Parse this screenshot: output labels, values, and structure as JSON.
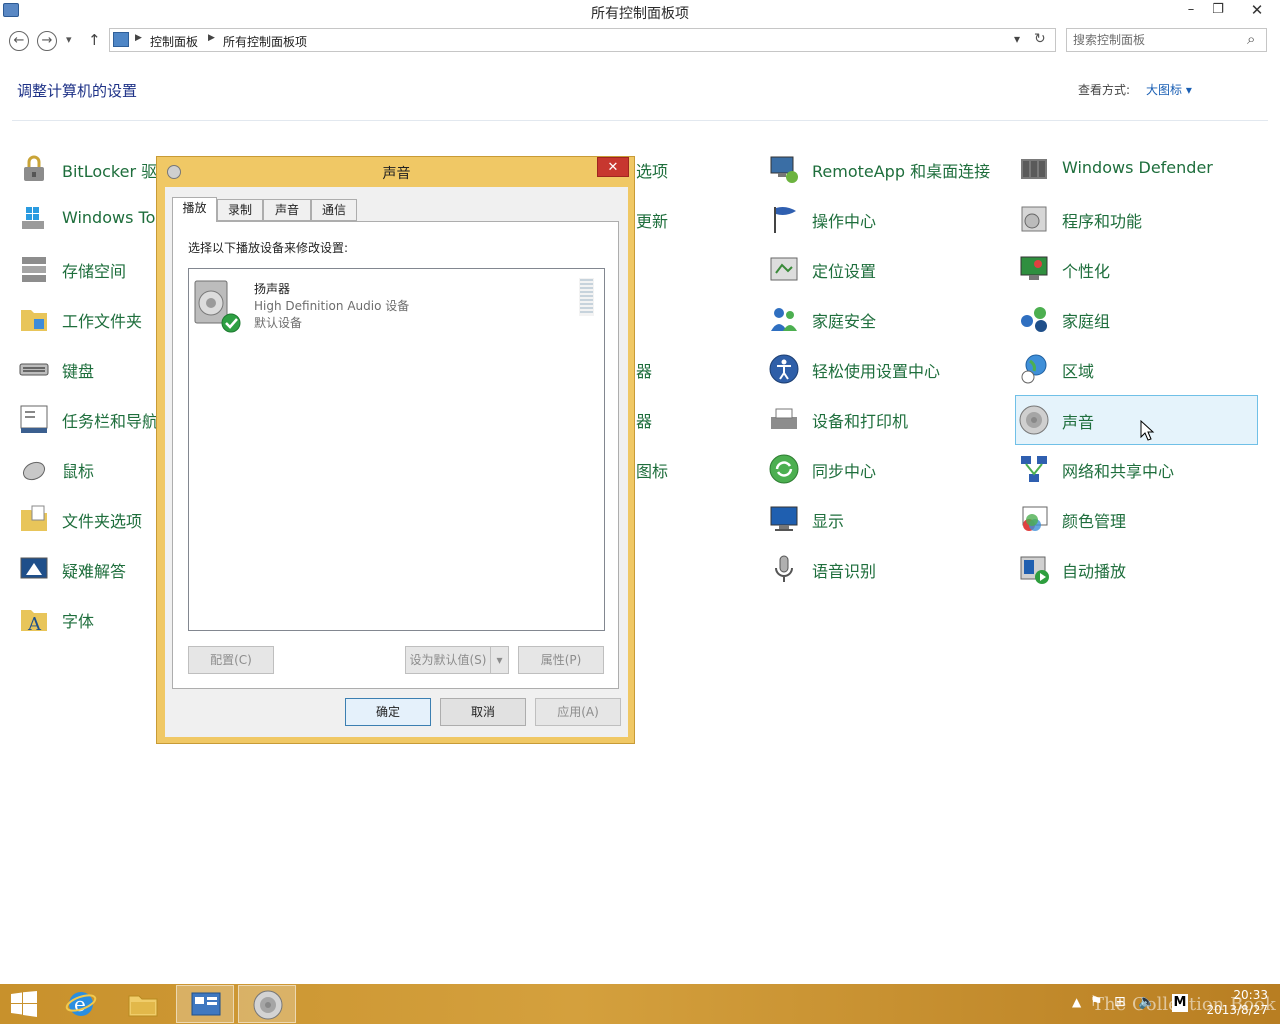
{
  "window": {
    "title": "所有控制面板项",
    "minimize": "–",
    "restore": "❐",
    "close": "✕"
  },
  "nav": {
    "back": "←",
    "forward": "→",
    "recent": "▾",
    "up": "↑",
    "breadcrumb": [
      "控制面板",
      "所有控制面板项"
    ],
    "address_dropdown": "▾",
    "refresh": "↻",
    "search_placeholder": "搜索控制面板",
    "search_icon": "⌕"
  },
  "header": {
    "title": "调整计算机的设置",
    "view_by_label": "查看方式:",
    "view_by_value": "大图标 ▾"
  },
  "items": {
    "col1": [
      "BitLocker 驱",
      "Windows To",
      "存储空间",
      "工作文件夹",
      "键盘",
      "任务栏和导航",
      "鼠标",
      "文件夹选项",
      "疑难解答",
      "字体"
    ],
    "col2_partial": [
      "选项",
      "更新",
      "器",
      "器",
      "图标"
    ],
    "col3": [
      "RemoteApp 和桌面连接",
      "操作中心",
      "定位设置",
      "家庭安全",
      "轻松使用设置中心",
      "设备和打印机",
      "同步中心",
      "显示",
      "语音识别"
    ],
    "col4": [
      "Windows Defender",
      "程序和功能",
      "个性化",
      "家庭组",
      "区域",
      "声音",
      "网络和共享中心",
      "颜色管理",
      "自动播放"
    ],
    "selected": "声音"
  },
  "dialog": {
    "title": "声音",
    "close": "✕",
    "tabs": [
      "播放",
      "录制",
      "声音",
      "通信"
    ],
    "active_tab": "播放",
    "instruction": "选择以下播放设备来修改设置:",
    "device": {
      "name": "扬声器",
      "description": "High Definition Audio 设备",
      "status": "默认设备"
    },
    "buttons": {
      "configure": "配置(C)",
      "set_default": "设为默认值(S)",
      "set_default_arrow": "▾",
      "properties": "属性(P)",
      "ok": "确定",
      "cancel": "取消",
      "apply": "应用(A)"
    }
  },
  "taskbar": {
    "time": "20:33",
    "date": "2013/8/27",
    "watermark": "The Collection Book"
  }
}
